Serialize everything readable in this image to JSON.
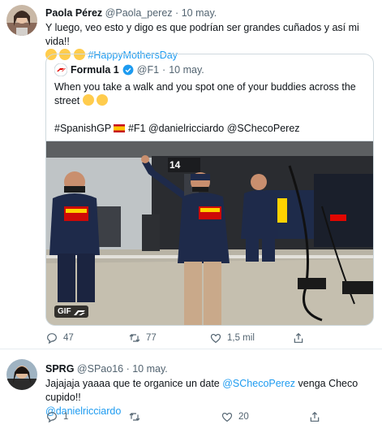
{
  "tweet1": {
    "author_name": "Paola Pérez",
    "handle": "@Paola_perez",
    "separator": "·",
    "date": "10 may.",
    "text_line1": "Y luego, veo esto y digo es que podrían ser grandes cuñados y así mi vida!!",
    "hashtag": "#HappyMothersDay",
    "quote": {
      "author_name": "Formula 1",
      "handle": "@F1",
      "separator": "·",
      "date": "10 may.",
      "text_line1": "When you take a walk and you spot one of your buddies across the",
      "text_line2": "street",
      "tags_line_a": "#SpanishGP",
      "tags_line_b": "#F1 @danielricciardo @SChecoPerez",
      "gif_label": "GIF"
    },
    "actions": {
      "reply_count": "47",
      "retweet_count": "77",
      "like_count": "1,5 mil"
    }
  },
  "tweet2": {
    "author_name": "SPRG",
    "handle": "@SPao16",
    "separator": "·",
    "date": "10 may.",
    "text_prefix": "Jajajaja yaaaa que te organice un date ",
    "mention1": "@SChecoPerez",
    "text_suffix": " venga Checo cupido!!",
    "mention2": "@danielricciardo",
    "actions": {
      "reply_count": "1",
      "retweet_count": "",
      "like_count": "20"
    }
  },
  "colors": {
    "link": "#1d9bf0",
    "muted": "#536471",
    "border": "#cfd9de",
    "verified": "#1d9bf0",
    "f1_red": "#e10600"
  },
  "icons": [
    "reply-icon",
    "retweet-icon",
    "like-icon",
    "share-icon",
    "verified-badge-icon",
    "f1-logo-icon",
    "rofl-emoji-icon",
    "spain-flag-icon"
  ]
}
